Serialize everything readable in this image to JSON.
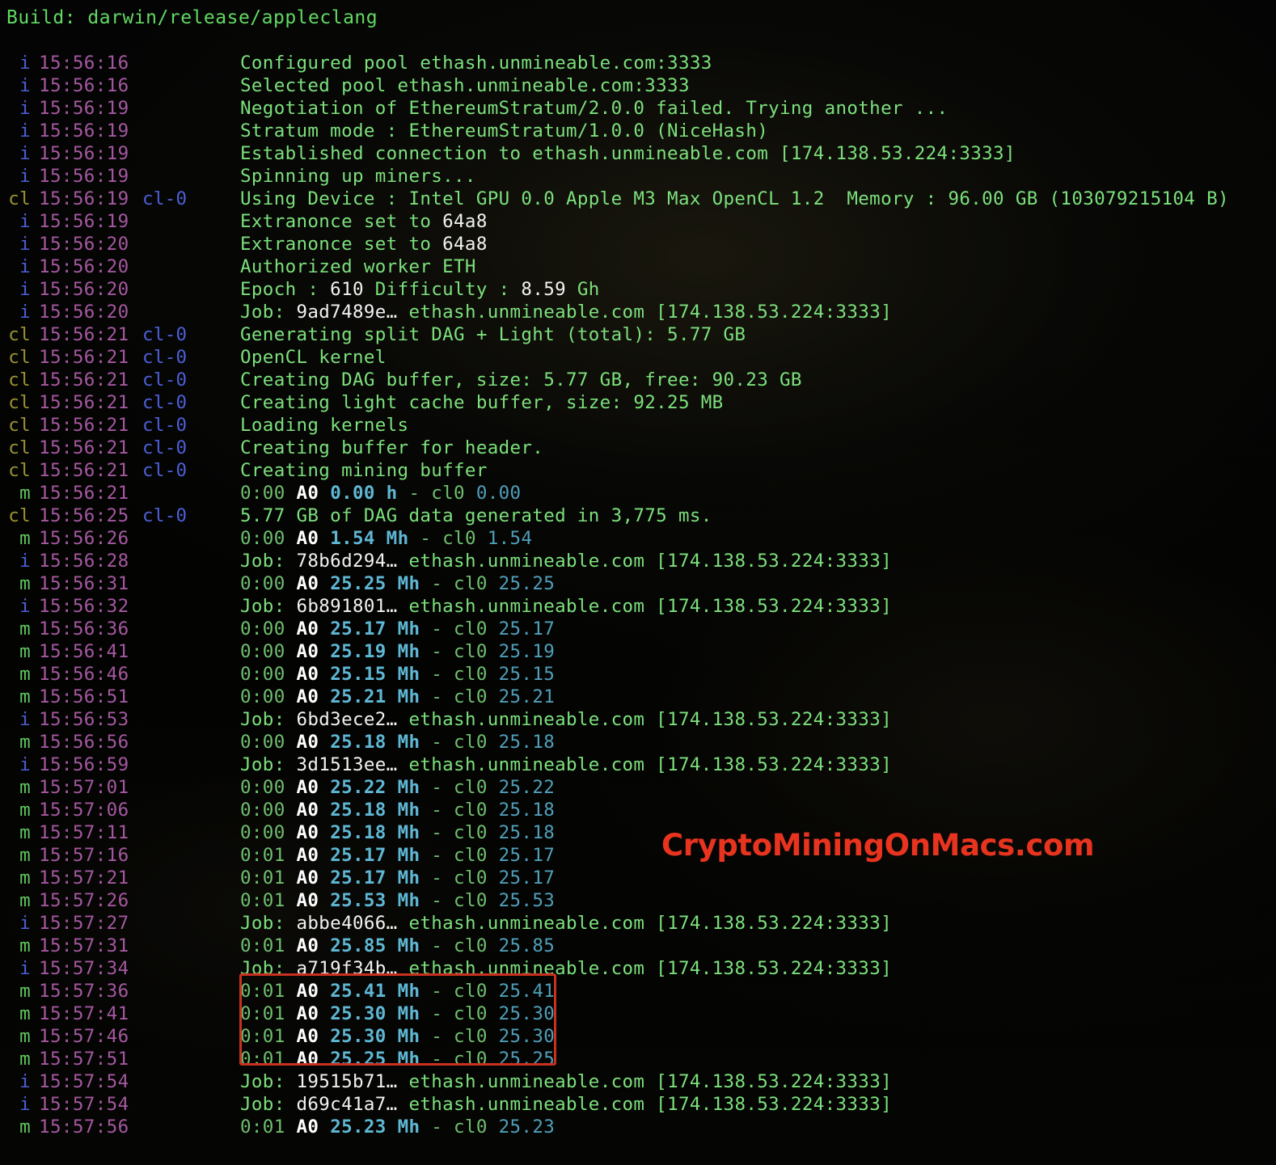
{
  "header": {
    "build_label": "Build: darwin/release/appleclang"
  },
  "watermark": {
    "text": "CryptoMiningOnMacs.com",
    "color": "#e8341f"
  },
  "colors": {
    "background": "#040404",
    "body_green": "#7ce07c",
    "timestamp_purple": "#a458a0",
    "tag_info_blue": "#4c5fd7",
    "tag_cl_olive": "#9a9133",
    "tag_miner_green": "#5fc85f",
    "hashrate_cyan": "#5fb7d4",
    "highlight_white": "#f2f2f2",
    "highlight_box_red": "#c9301f"
  },
  "highlight_box": {
    "description": "red rectangle around four miner hashrate rows",
    "rows": [
      "15:57:36",
      "15:57:41",
      "15:57:46",
      "15:57:51"
    ]
  },
  "log_rows": [
    {
      "tag": "i",
      "ts": "15:56:16",
      "dev": "",
      "parts": [
        {
          "t": "Configured pool ethash.unmineable.com:3333",
          "c": "g"
        }
      ]
    },
    {
      "tag": "i",
      "ts": "15:56:16",
      "dev": "",
      "parts": [
        {
          "t": "Selected pool ethash.unmineable.com:3333",
          "c": "g"
        }
      ]
    },
    {
      "tag": "i",
      "ts": "15:56:19",
      "dev": "",
      "parts": [
        {
          "t": "Negotiation of EthereumStratum/2.0.0 failed. Trying another ...",
          "c": "g"
        }
      ]
    },
    {
      "tag": "i",
      "ts": "15:56:19",
      "dev": "",
      "parts": [
        {
          "t": "Stratum mode : EthereumStratum/1.0.0 (NiceHash)",
          "c": "g"
        }
      ]
    },
    {
      "tag": "i",
      "ts": "15:56:19",
      "dev": "",
      "parts": [
        {
          "t": "Established connection to ethash.unmineable.com [174.138.53.224:3333]",
          "c": "g"
        }
      ]
    },
    {
      "tag": "i",
      "ts": "15:56:19",
      "dev": "",
      "parts": [
        {
          "t": "Spinning up miners...",
          "c": "g"
        }
      ]
    },
    {
      "tag": "cl",
      "ts": "15:56:19",
      "dev": "cl-0",
      "parts": [
        {
          "t": "Using Device : Intel GPU 0.0 Apple M3 Max OpenCL 1.2  Memory : 96.00 GB (103079215104 B)",
          "c": "g"
        }
      ]
    },
    {
      "tag": "i",
      "ts": "15:56:19",
      "dev": "",
      "parts": [
        {
          "t": "Extranonce set to ",
          "c": "g"
        },
        {
          "t": "64a8",
          "c": "w"
        }
      ]
    },
    {
      "tag": "i",
      "ts": "15:56:20",
      "dev": "",
      "parts": [
        {
          "t": "Extranonce set to ",
          "c": "g"
        },
        {
          "t": "64a8",
          "c": "w"
        }
      ]
    },
    {
      "tag": "i",
      "ts": "15:56:20",
      "dev": "",
      "parts": [
        {
          "t": "Authorized worker ETH",
          "c": "g"
        }
      ]
    },
    {
      "tag": "i",
      "ts": "15:56:20",
      "dev": "",
      "parts": [
        {
          "t": "Epoch : ",
          "c": "g"
        },
        {
          "t": "610",
          "c": "w"
        },
        {
          "t": " Difficulty : ",
          "c": "g"
        },
        {
          "t": "8.59",
          "c": "w"
        },
        {
          "t": " Gh",
          "c": "g"
        }
      ]
    },
    {
      "tag": "i",
      "ts": "15:56:20",
      "dev": "",
      "parts": [
        {
          "t": "Job: ",
          "c": "g"
        },
        {
          "t": "9ad7489e…",
          "c": "w"
        },
        {
          "t": " ethash.unmineable.com [174.138.53.224:3333]",
          "c": "g"
        }
      ]
    },
    {
      "tag": "cl",
      "ts": "15:56:21",
      "dev": "cl-0",
      "parts": [
        {
          "t": "Generating split DAG + Light (total): 5.77 GB",
          "c": "g"
        }
      ]
    },
    {
      "tag": "cl",
      "ts": "15:56:21",
      "dev": "cl-0",
      "parts": [
        {
          "t": "OpenCL kernel",
          "c": "g"
        }
      ]
    },
    {
      "tag": "cl",
      "ts": "15:56:21",
      "dev": "cl-0",
      "parts": [
        {
          "t": "Creating DAG buffer, size: 5.77 GB, free: 90.23 GB",
          "c": "g"
        }
      ]
    },
    {
      "tag": "cl",
      "ts": "15:56:21",
      "dev": "cl-0",
      "parts": [
        {
          "t": "Creating light cache buffer, size: 92.25 MB",
          "c": "g"
        }
      ]
    },
    {
      "tag": "cl",
      "ts": "15:56:21",
      "dev": "cl-0",
      "parts": [
        {
          "t": "Loading kernels",
          "c": "g"
        }
      ]
    },
    {
      "tag": "cl",
      "ts": "15:56:21",
      "dev": "cl-0",
      "parts": [
        {
          "t": "Creating buffer for header.",
          "c": "g"
        }
      ]
    },
    {
      "tag": "cl",
      "ts": "15:56:21",
      "dev": "cl-0",
      "parts": [
        {
          "t": "Creating mining buffer",
          "c": "g"
        }
      ]
    },
    {
      "tag": "m",
      "ts": "15:56:21",
      "dev": "",
      "parts": [
        {
          "t": "0:00 ",
          "c": "gd"
        },
        {
          "t": "A0",
          "c": "wb"
        },
        {
          "t": " ",
          "c": "g"
        },
        {
          "t": "0.00 h",
          "c": "c"
        },
        {
          "t": " - cl0 ",
          "c": "gd"
        },
        {
          "t": "0.00",
          "c": "cd"
        }
      ]
    },
    {
      "tag": "cl",
      "ts": "15:56:25",
      "dev": "cl-0",
      "parts": [
        {
          "t": "5.77 GB of DAG data generated in 3,775 ms.",
          "c": "g"
        }
      ]
    },
    {
      "tag": "m",
      "ts": "15:56:26",
      "dev": "",
      "parts": [
        {
          "t": "0:00 ",
          "c": "gd"
        },
        {
          "t": "A0",
          "c": "wb"
        },
        {
          "t": " ",
          "c": "g"
        },
        {
          "t": "1.54 Mh",
          "c": "c"
        },
        {
          "t": " - cl0 ",
          "c": "gd"
        },
        {
          "t": "1.54",
          "c": "cd"
        }
      ]
    },
    {
      "tag": "i",
      "ts": "15:56:28",
      "dev": "",
      "parts": [
        {
          "t": "Job: ",
          "c": "g"
        },
        {
          "t": "78b6d294…",
          "c": "w"
        },
        {
          "t": " ethash.unmineable.com [174.138.53.224:3333]",
          "c": "g"
        }
      ]
    },
    {
      "tag": "m",
      "ts": "15:56:31",
      "dev": "",
      "parts": [
        {
          "t": "0:00 ",
          "c": "gd"
        },
        {
          "t": "A0",
          "c": "wb"
        },
        {
          "t": " ",
          "c": "g"
        },
        {
          "t": "25.25 Mh",
          "c": "c"
        },
        {
          "t": " - cl0 ",
          "c": "gd"
        },
        {
          "t": "25.25",
          "c": "cd"
        }
      ]
    },
    {
      "tag": "i",
      "ts": "15:56:32",
      "dev": "",
      "parts": [
        {
          "t": "Job: ",
          "c": "g"
        },
        {
          "t": "6b891801…",
          "c": "w"
        },
        {
          "t": " ethash.unmineable.com [174.138.53.224:3333]",
          "c": "g"
        }
      ]
    },
    {
      "tag": "m",
      "ts": "15:56:36",
      "dev": "",
      "parts": [
        {
          "t": "0:00 ",
          "c": "gd"
        },
        {
          "t": "A0",
          "c": "wb"
        },
        {
          "t": " ",
          "c": "g"
        },
        {
          "t": "25.17 Mh",
          "c": "c"
        },
        {
          "t": " - cl0 ",
          "c": "gd"
        },
        {
          "t": "25.17",
          "c": "cd"
        }
      ]
    },
    {
      "tag": "m",
      "ts": "15:56:41",
      "dev": "",
      "parts": [
        {
          "t": "0:00 ",
          "c": "gd"
        },
        {
          "t": "A0",
          "c": "wb"
        },
        {
          "t": " ",
          "c": "g"
        },
        {
          "t": "25.19 Mh",
          "c": "c"
        },
        {
          "t": " - cl0 ",
          "c": "gd"
        },
        {
          "t": "25.19",
          "c": "cd"
        }
      ]
    },
    {
      "tag": "m",
      "ts": "15:56:46",
      "dev": "",
      "parts": [
        {
          "t": "0:00 ",
          "c": "gd"
        },
        {
          "t": "A0",
          "c": "wb"
        },
        {
          "t": " ",
          "c": "g"
        },
        {
          "t": "25.15 Mh",
          "c": "c"
        },
        {
          "t": " - cl0 ",
          "c": "gd"
        },
        {
          "t": "25.15",
          "c": "cd"
        }
      ]
    },
    {
      "tag": "m",
      "ts": "15:56:51",
      "dev": "",
      "parts": [
        {
          "t": "0:00 ",
          "c": "gd"
        },
        {
          "t": "A0",
          "c": "wb"
        },
        {
          "t": " ",
          "c": "g"
        },
        {
          "t": "25.21 Mh",
          "c": "c"
        },
        {
          "t": " - cl0 ",
          "c": "gd"
        },
        {
          "t": "25.21",
          "c": "cd"
        }
      ]
    },
    {
      "tag": "i",
      "ts": "15:56:53",
      "dev": "",
      "parts": [
        {
          "t": "Job: ",
          "c": "g"
        },
        {
          "t": "6bd3ece2…",
          "c": "w"
        },
        {
          "t": " ethash.unmineable.com [174.138.53.224:3333]",
          "c": "g"
        }
      ]
    },
    {
      "tag": "m",
      "ts": "15:56:56",
      "dev": "",
      "parts": [
        {
          "t": "0:00 ",
          "c": "gd"
        },
        {
          "t": "A0",
          "c": "wb"
        },
        {
          "t": " ",
          "c": "g"
        },
        {
          "t": "25.18 Mh",
          "c": "c"
        },
        {
          "t": " - cl0 ",
          "c": "gd"
        },
        {
          "t": "25.18",
          "c": "cd"
        }
      ]
    },
    {
      "tag": "i",
      "ts": "15:56:59",
      "dev": "",
      "parts": [
        {
          "t": "Job: ",
          "c": "g"
        },
        {
          "t": "3d1513ee…",
          "c": "w"
        },
        {
          "t": " ethash.unmineable.com [174.138.53.224:3333]",
          "c": "g"
        }
      ]
    },
    {
      "tag": "m",
      "ts": "15:57:01",
      "dev": "",
      "parts": [
        {
          "t": "0:00 ",
          "c": "gd"
        },
        {
          "t": "A0",
          "c": "wb"
        },
        {
          "t": " ",
          "c": "g"
        },
        {
          "t": "25.22 Mh",
          "c": "c"
        },
        {
          "t": " - cl0 ",
          "c": "gd"
        },
        {
          "t": "25.22",
          "c": "cd"
        }
      ]
    },
    {
      "tag": "m",
      "ts": "15:57:06",
      "dev": "",
      "parts": [
        {
          "t": "0:00 ",
          "c": "gd"
        },
        {
          "t": "A0",
          "c": "wb"
        },
        {
          "t": " ",
          "c": "g"
        },
        {
          "t": "25.18 Mh",
          "c": "c"
        },
        {
          "t": " - cl0 ",
          "c": "gd"
        },
        {
          "t": "25.18",
          "c": "cd"
        }
      ]
    },
    {
      "tag": "m",
      "ts": "15:57:11",
      "dev": "",
      "parts": [
        {
          "t": "0:00 ",
          "c": "gd"
        },
        {
          "t": "A0",
          "c": "wb"
        },
        {
          "t": " ",
          "c": "g"
        },
        {
          "t": "25.18 Mh",
          "c": "c"
        },
        {
          "t": " - cl0 ",
          "c": "gd"
        },
        {
          "t": "25.18",
          "c": "cd"
        }
      ]
    },
    {
      "tag": "m",
      "ts": "15:57:16",
      "dev": "",
      "parts": [
        {
          "t": "0:01 ",
          "c": "gd"
        },
        {
          "t": "A0",
          "c": "wb"
        },
        {
          "t": " ",
          "c": "g"
        },
        {
          "t": "25.17 Mh",
          "c": "c"
        },
        {
          "t": " - cl0 ",
          "c": "gd"
        },
        {
          "t": "25.17",
          "c": "cd"
        }
      ]
    },
    {
      "tag": "m",
      "ts": "15:57:21",
      "dev": "",
      "parts": [
        {
          "t": "0:01 ",
          "c": "gd"
        },
        {
          "t": "A0",
          "c": "wb"
        },
        {
          "t": " ",
          "c": "g"
        },
        {
          "t": "25.17 Mh",
          "c": "c"
        },
        {
          "t": " - cl0 ",
          "c": "gd"
        },
        {
          "t": "25.17",
          "c": "cd"
        }
      ]
    },
    {
      "tag": "m",
      "ts": "15:57:26",
      "dev": "",
      "parts": [
        {
          "t": "0:01 ",
          "c": "gd"
        },
        {
          "t": "A0",
          "c": "wb"
        },
        {
          "t": " ",
          "c": "g"
        },
        {
          "t": "25.53 Mh",
          "c": "c"
        },
        {
          "t": " - cl0 ",
          "c": "gd"
        },
        {
          "t": "25.53",
          "c": "cd"
        }
      ]
    },
    {
      "tag": "i",
      "ts": "15:57:27",
      "dev": "",
      "parts": [
        {
          "t": "Job: ",
          "c": "g"
        },
        {
          "t": "abbe4066…",
          "c": "w"
        },
        {
          "t": " ethash.unmineable.com [174.138.53.224:3333]",
          "c": "g"
        }
      ]
    },
    {
      "tag": "m",
      "ts": "15:57:31",
      "dev": "",
      "parts": [
        {
          "t": "0:01 ",
          "c": "gd"
        },
        {
          "t": "A0",
          "c": "wb"
        },
        {
          "t": " ",
          "c": "g"
        },
        {
          "t": "25.85 Mh",
          "c": "c"
        },
        {
          "t": " - cl0 ",
          "c": "gd"
        },
        {
          "t": "25.85",
          "c": "cd"
        }
      ]
    },
    {
      "tag": "i",
      "ts": "15:57:34",
      "dev": "",
      "parts": [
        {
          "t": "Job: ",
          "c": "g"
        },
        {
          "t": "a719f34b…",
          "c": "w"
        },
        {
          "t": " ethash.unmineable.com [174.138.53.224:3333]",
          "c": "g"
        }
      ]
    },
    {
      "tag": "m",
      "ts": "15:57:36",
      "dev": "",
      "parts": [
        {
          "t": "0:01 ",
          "c": "gd"
        },
        {
          "t": "A0",
          "c": "wb"
        },
        {
          "t": " ",
          "c": "g"
        },
        {
          "t": "25.41 Mh",
          "c": "c"
        },
        {
          "t": " - cl0 ",
          "c": "gd"
        },
        {
          "t": "25.41",
          "c": "cd"
        }
      ]
    },
    {
      "tag": "m",
      "ts": "15:57:41",
      "dev": "",
      "parts": [
        {
          "t": "0:01 ",
          "c": "gd"
        },
        {
          "t": "A0",
          "c": "wb"
        },
        {
          "t": " ",
          "c": "g"
        },
        {
          "t": "25.30 Mh",
          "c": "c"
        },
        {
          "t": " - cl0 ",
          "c": "gd"
        },
        {
          "t": "25.30",
          "c": "cd"
        }
      ]
    },
    {
      "tag": "m",
      "ts": "15:57:46",
      "dev": "",
      "parts": [
        {
          "t": "0:01 ",
          "c": "gd"
        },
        {
          "t": "A0",
          "c": "wb"
        },
        {
          "t": " ",
          "c": "g"
        },
        {
          "t": "25.30 Mh",
          "c": "c"
        },
        {
          "t": " - cl0 ",
          "c": "gd"
        },
        {
          "t": "25.30",
          "c": "cd"
        }
      ]
    },
    {
      "tag": "m",
      "ts": "15:57:51",
      "dev": "",
      "parts": [
        {
          "t": "0:01 ",
          "c": "gd"
        },
        {
          "t": "A0",
          "c": "wb"
        },
        {
          "t": " ",
          "c": "g"
        },
        {
          "t": "25.25 Mh",
          "c": "c"
        },
        {
          "t": " - cl0 ",
          "c": "gd"
        },
        {
          "t": "25.25",
          "c": "cd"
        }
      ]
    },
    {
      "tag": "i",
      "ts": "15:57:54",
      "dev": "",
      "parts": [
        {
          "t": "Job: ",
          "c": "g"
        },
        {
          "t": "19515b71…",
          "c": "w"
        },
        {
          "t": " ethash.unmineable.com [174.138.53.224:3333]",
          "c": "g"
        }
      ]
    },
    {
      "tag": "i",
      "ts": "15:57:54",
      "dev": "",
      "parts": [
        {
          "t": "Job: ",
          "c": "g"
        },
        {
          "t": "d69c41a7…",
          "c": "w"
        },
        {
          "t": " ethash.unmineable.com [174.138.53.224:3333]",
          "c": "g"
        }
      ]
    },
    {
      "tag": "m",
      "ts": "15:57:56",
      "dev": "",
      "parts": [
        {
          "t": "0:01 ",
          "c": "gd"
        },
        {
          "t": "A0",
          "c": "wb"
        },
        {
          "t": " ",
          "c": "g"
        },
        {
          "t": "25.23 Mh",
          "c": "c"
        },
        {
          "t": " - cl0 ",
          "c": "gd"
        },
        {
          "t": "25.23",
          "c": "cd"
        }
      ]
    }
  ]
}
